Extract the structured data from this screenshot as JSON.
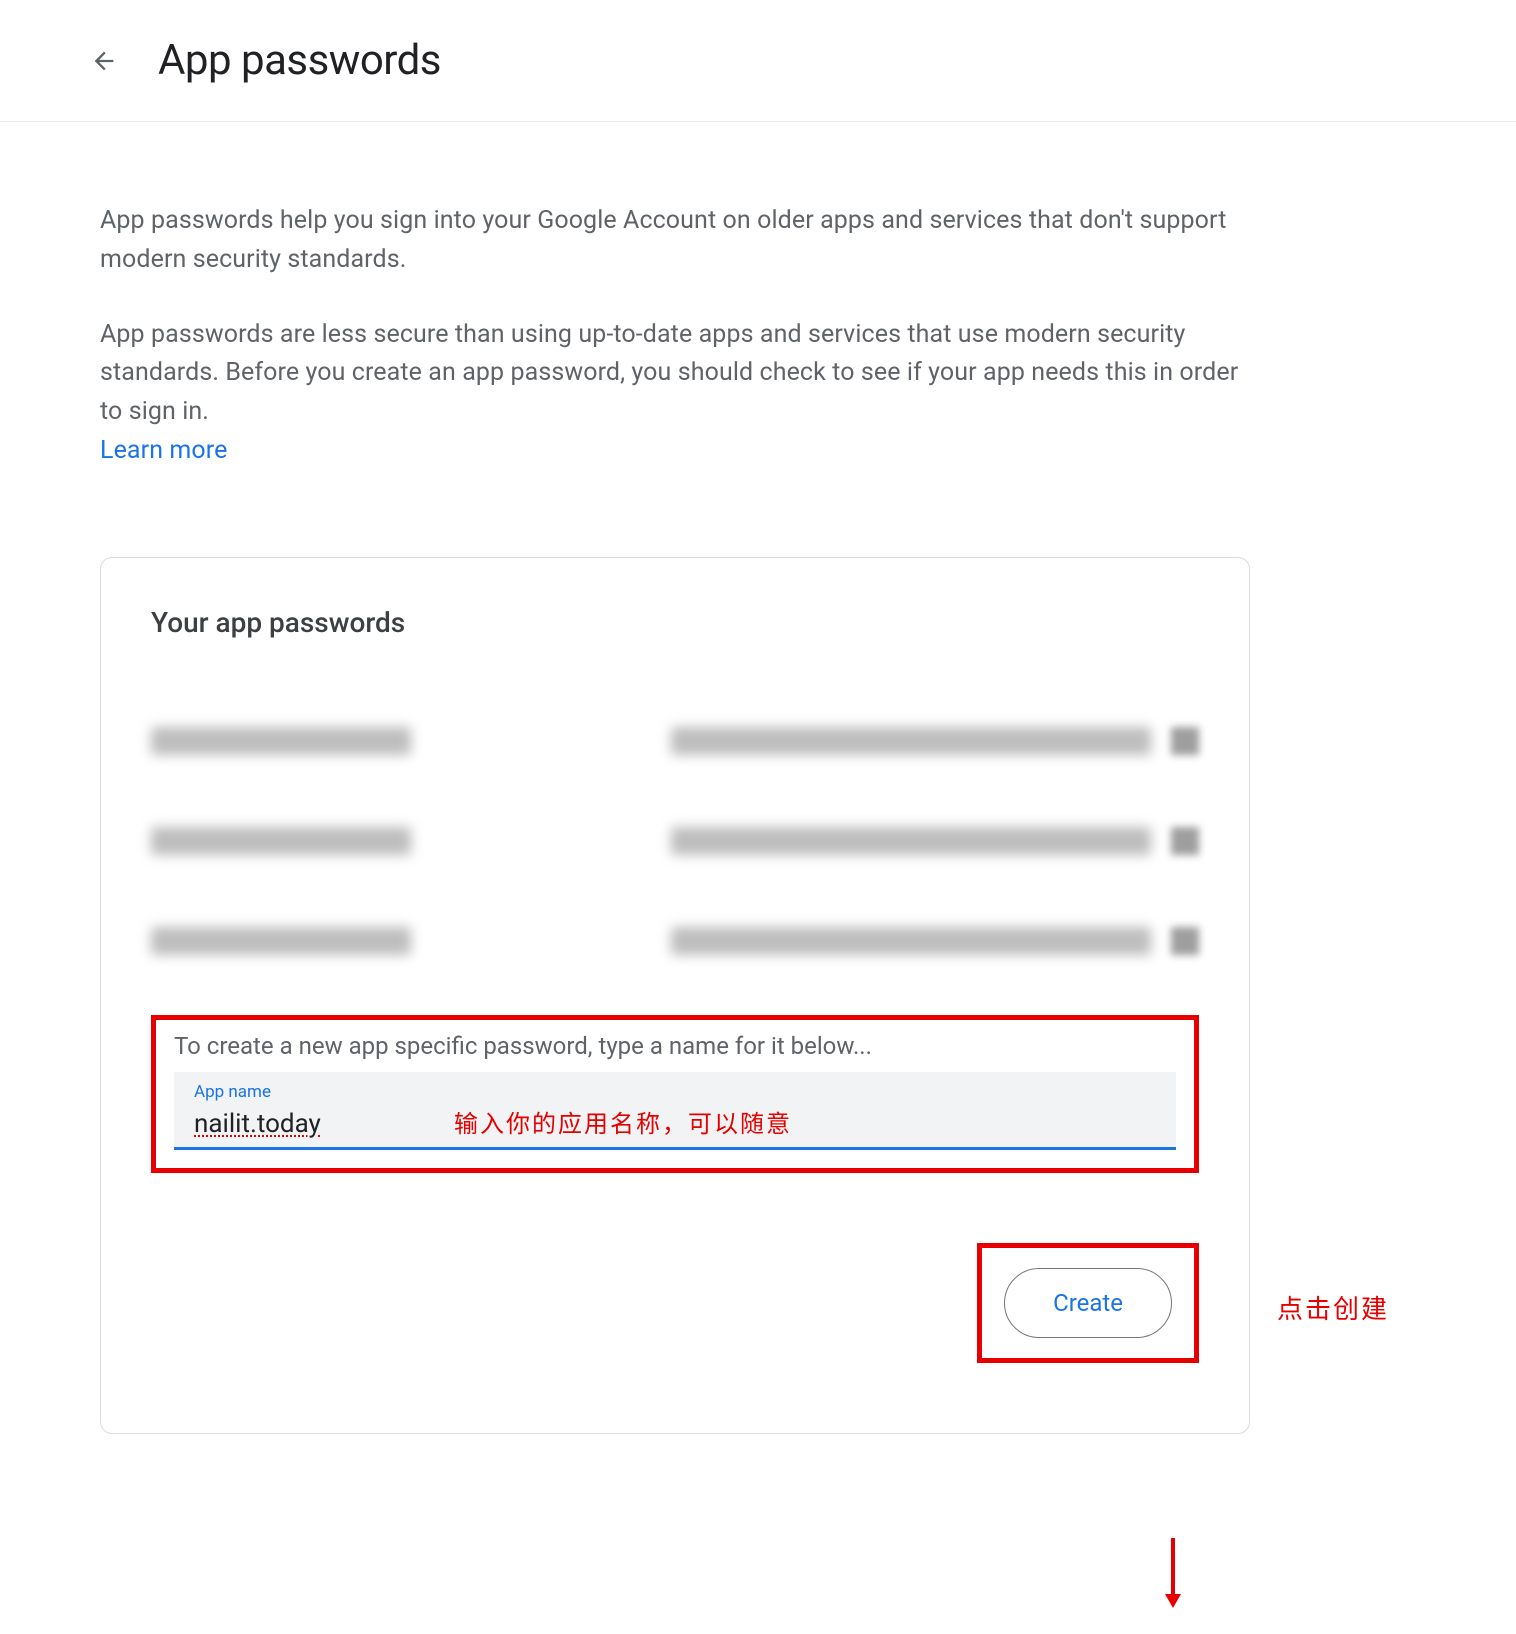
{
  "header": {
    "title": "App passwords"
  },
  "description": {
    "paragraph1": "App passwords help you sign into your Google Account on older apps and services that don't support modern security standards.",
    "paragraph2": "App passwords are less secure than using up-to-date apps and services that use modern security standards. Before you create an app password, you should check to see if your app needs this in order to sign in.",
    "learn_more": "Learn more"
  },
  "card": {
    "title": "Your app passwords",
    "create_prompt": "To create a new app specific password, type a name for it below...",
    "input_label": "App name",
    "input_value": "nailit.today",
    "create_button": "Create"
  },
  "annotations": {
    "input_hint": "输入你的应用名称，可以随意",
    "create_hint": "点击创建"
  }
}
